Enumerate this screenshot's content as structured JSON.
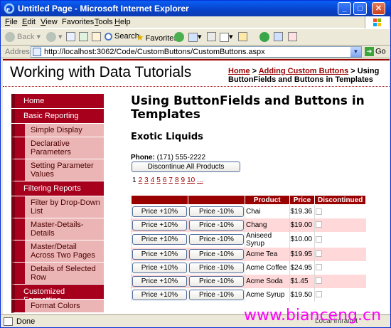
{
  "window": {
    "title": "Untitled Page - Microsoft Internet Explorer",
    "controls": [
      "_",
      "□",
      "✕"
    ]
  },
  "menubar": {
    "items": [
      {
        "u": "F",
        "rest": "ile"
      },
      {
        "u": "E",
        "rest": "dit"
      },
      {
        "u": "V",
        "rest": "iew"
      },
      {
        "u": "",
        "pre": "F",
        "rest": "avorites",
        "uAt": "a"
      },
      {
        "u": "T",
        "rest": "ools"
      },
      {
        "u": "H",
        "rest": "elp"
      }
    ]
  },
  "toolbar": {
    "back": "Back",
    "search": "Search",
    "favorites": "Favorites"
  },
  "address": {
    "label": "Address",
    "url": "http://localhost:3062/Code/CustomButtons/CustomButtons.aspx",
    "go": "Go"
  },
  "site": {
    "title": "Working with Data Tutorials",
    "breadcrumb": {
      "home": "Home",
      "sep1": " > ",
      "section": "Adding Custom Buttons",
      "sep2": " > ",
      "current": "Using ButtonFields and Buttons in Templates"
    }
  },
  "menu": [
    {
      "type": "header",
      "label": "Home"
    },
    {
      "type": "header",
      "label": "Basic Reporting"
    },
    {
      "type": "sub",
      "label": "Simple Display"
    },
    {
      "type": "sub",
      "label": "Declarative Parameters"
    },
    {
      "type": "sub",
      "label": "Setting Parameter Values"
    },
    {
      "type": "header",
      "label": "Filtering Reports"
    },
    {
      "type": "sub",
      "label": "Filter by Drop-Down List"
    },
    {
      "type": "sub",
      "label": "Master-Details-Details"
    },
    {
      "type": "sub",
      "label": "Master/Detail Across Two Pages"
    },
    {
      "type": "sub",
      "label": "Details of Selected Row"
    },
    {
      "type": "header",
      "label": "Customized Formatting"
    },
    {
      "type": "sub",
      "label": "Format Colors"
    }
  ],
  "main": {
    "heading": "Using ButtonFields and Buttons in Templates",
    "company": "Exotic Liquids",
    "phone_label": "Phone:",
    "phone": "(171) 555-2222",
    "discontinue_all": "Discontinue All Products",
    "pager": {
      "current": "1",
      "pages": [
        "2",
        "3",
        "4",
        "5",
        "6",
        "7",
        "8",
        "9",
        "10",
        "..."
      ]
    },
    "grid": {
      "headers": [
        "",
        "",
        "Product",
        "Price",
        "Discontinued"
      ],
      "btn_up": "Price +10%",
      "btn_down": "Price -10%",
      "rows": [
        {
          "product": "Chai",
          "price": "$19.36"
        },
        {
          "product": "Chang",
          "price": "$19.00"
        },
        {
          "product": "Aniseed Syrup",
          "price": "$10.00"
        },
        {
          "product": "Acme Tea",
          "price": "$19.95"
        },
        {
          "product": "Acme Coffee",
          "price": "$24.95"
        },
        {
          "product": "Acme Soda",
          "price": "$1.45"
        },
        {
          "product": "Acme Syrup",
          "price": "$19.50"
        }
      ]
    }
  },
  "status": {
    "text": "Done",
    "zone": "Local intranet"
  },
  "watermark": "www.bianceng.cn"
}
